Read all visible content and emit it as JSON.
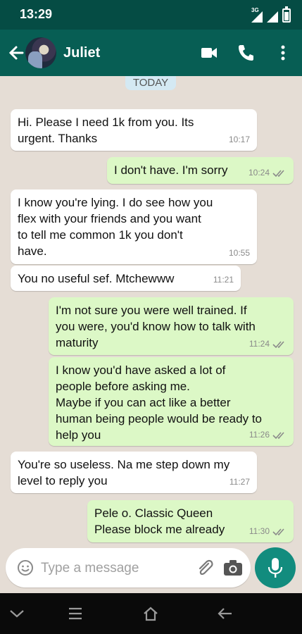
{
  "status_bar": {
    "time": "13:29",
    "network": "3G"
  },
  "header": {
    "contact_name": "Juliet"
  },
  "chat": {
    "date_label": "TODAY",
    "messages": [
      {
        "direction": "in",
        "text": "Hi. Please I need 1k from you. Its\nurgent. Thanks",
        "time": "10:17"
      },
      {
        "direction": "out",
        "text": "I don't have. I'm sorry",
        "time": "10:24",
        "read": true
      },
      {
        "direction": "in",
        "text": "I know you're lying. I do see how you\nflex with your friends and you want\nto tell me common 1k you don't\nhave.",
        "time": "10:55"
      },
      {
        "direction": "in",
        "text": "You no useful sef. Mtchewww",
        "time": "11:21"
      },
      {
        "direction": "out",
        "text": "I'm not sure you were well trained. If\nyou were, you'd know how to talk with\nmaturity",
        "time": "11:24",
        "read": true
      },
      {
        "direction": "out",
        "text": "I know you'd have asked a lot of\npeople before asking me.\nMaybe if you can act like a better\nhuman being people would be ready to\nhelp you",
        "time": "11:26",
        "read": true
      },
      {
        "direction": "in",
        "text": "You're so useless. Na me step down my\nlevel to reply you",
        "time": "11:27"
      },
      {
        "direction": "out",
        "text": "Pele o. Classic Queen\nPlease block me already",
        "time": "11:30",
        "read": true
      }
    ]
  },
  "composer": {
    "placeholder": "Type a message"
  },
  "colors": {
    "header": "#075e54",
    "status_bar": "#054c44",
    "chat_background": "#e5ddd5",
    "incoming_bubble": "#ffffff",
    "outgoing_bubble": "#dcf8c6",
    "mic_button": "#128c7e",
    "read_ticks": "#8a8a8a"
  },
  "icons": {
    "header": [
      "back-arrow-icon",
      "video-call-icon",
      "phone-icon",
      "more-vert-icon"
    ],
    "composer": [
      "emoji-icon",
      "attach-icon",
      "camera-icon",
      "mic-icon"
    ],
    "nav": [
      "nav-collapse-icon",
      "nav-menu-icon",
      "nav-home-icon",
      "nav-back-icon"
    ]
  }
}
